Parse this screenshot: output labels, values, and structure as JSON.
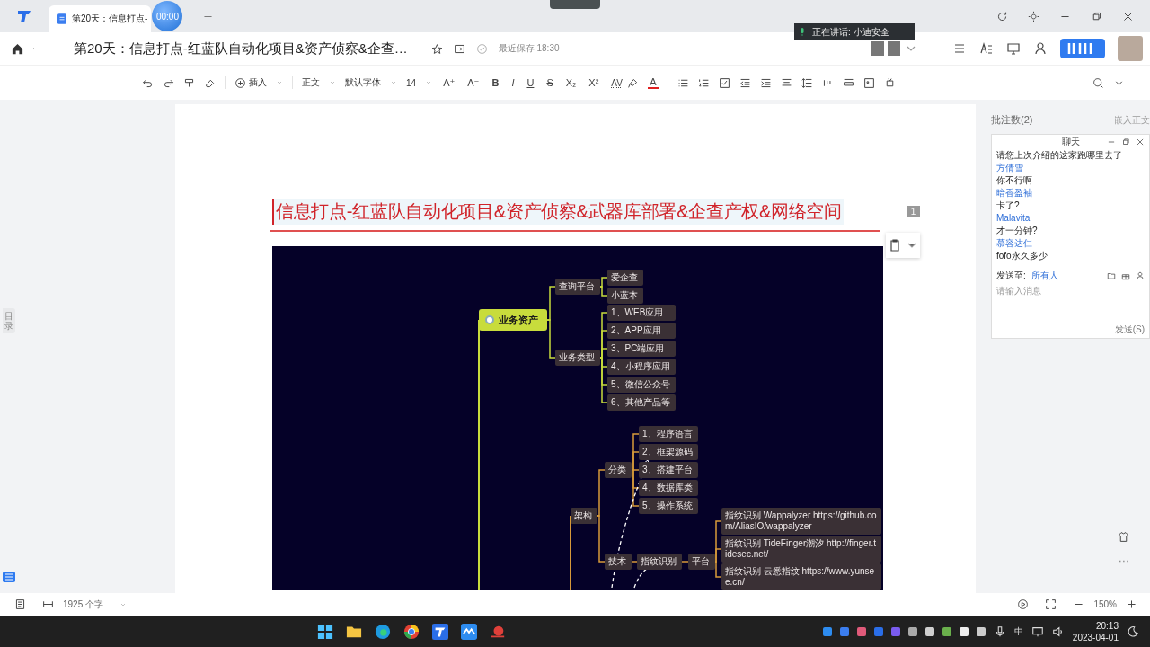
{
  "tab_bar": {
    "tab_title": "第20天：信息打点-",
    "timer": "00:00"
  },
  "header": {
    "doc_title": "第20天：信息打点-红蓝队自动化项目&资产侦察&企查…",
    "save_status": "最近保存 18:30",
    "speaking_banner": "正在讲话: 小迪安全"
  },
  "toolbar": {
    "insert": "插入",
    "style": "正文",
    "font": "默认字体",
    "size": "14",
    "format_buttons": [
      {
        "kind": "plain",
        "label": "A⁺"
      },
      {
        "kind": "plain",
        "label": "A⁻"
      },
      {
        "kind": "bold",
        "label": "B"
      },
      {
        "kind": "italic",
        "label": "I"
      },
      {
        "kind": "underline",
        "label": "U"
      },
      {
        "kind": "strike",
        "label": "S"
      },
      {
        "kind": "plain",
        "label": "X₂"
      },
      {
        "kind": "plain",
        "label": "X²"
      },
      {
        "kind": "spacing",
        "label": "AV"
      }
    ],
    "font_color": {
      "label": "A",
      "color": "#e02020"
    }
  },
  "side_tab": "目录",
  "document": {
    "heading": "信息打点-红蓝队自动化项目&资产侦察&武器库部署&企查产权&网络空间",
    "page_number": "1",
    "mindmap": [
      {
        "label": "业务资产",
        "color": "#c8dc3c",
        "children": [
          {
            "label": "查询平台",
            "children": [
              {
                "label": "爱企查"
              },
              {
                "label": "小蓝本"
              }
            ]
          },
          {
            "label": "业务类型",
            "children": [
              {
                "label": "1、WEB应用"
              },
              {
                "label": "2、APP应用"
              },
              {
                "label": "3、PC端应用"
              },
              {
                "label": "4、小程序应用"
              },
              {
                "label": "5、微信公众号"
              },
              {
                "label": "6、其他产品等"
              }
            ]
          }
        ]
      },
      {
        "label": "架构",
        "color": "#d89a3a",
        "children": [
          {
            "label": "分类",
            "children": [
              {
                "label": "1、程序语言"
              },
              {
                "label": "2、框架源码"
              },
              {
                "label": "3、搭建平台"
              },
              {
                "label": "4、数据库类"
              },
              {
                "label": "5、操作系统"
              }
            ]
          },
          {
            "label": "技术",
            "children": [
              {
                "label": "指纹识别",
                "children": [
                  {
                    "label": "平台",
                    "children": [
                      {
                        "label": "指纹识别 Wappalyzer https://github.com/AliasIO/wappalyzer"
                      },
                      {
                        "label": "指纹识别 TideFinger潮汐 http://finger.tidesec.net/"
                      },
                      {
                        "label": "指纹识别 云悉指纹 https://www.yunsee.cn/"
                      }
                    ]
                  }
                ]
              }
            ]
          }
        ]
      }
    ]
  },
  "comments_panel": {
    "title": "批注数(2)",
    "embed_label": "嵌入正文"
  },
  "chat": {
    "title": "聊天",
    "messages": [
      {
        "kind": "text",
        "text": "请您上次介绍的这家跑哪里去了"
      },
      {
        "kind": "name",
        "text": "方倩雪"
      },
      {
        "kind": "text",
        "text": "你不行啊"
      },
      {
        "kind": "name",
        "text": "暗香盈袖"
      },
      {
        "kind": "text",
        "text": "卡了?"
      },
      {
        "kind": "name",
        "text": "Malavita"
      },
      {
        "kind": "text",
        "text": "才一分钟?"
      },
      {
        "kind": "name",
        "text": "慕容达仁"
      },
      {
        "kind": "text",
        "text": "fofo永久多少"
      }
    ],
    "send_to_label": "发送至:",
    "recipient": "所有人",
    "input_placeholder": "请输入消息",
    "send_button": "发送(S)"
  },
  "status_bar": {
    "word_count": "1925 个字",
    "zoom": "150%"
  },
  "taskbar": {
    "ime": "中",
    "time": "20:13",
    "date": "2023-04-01"
  }
}
